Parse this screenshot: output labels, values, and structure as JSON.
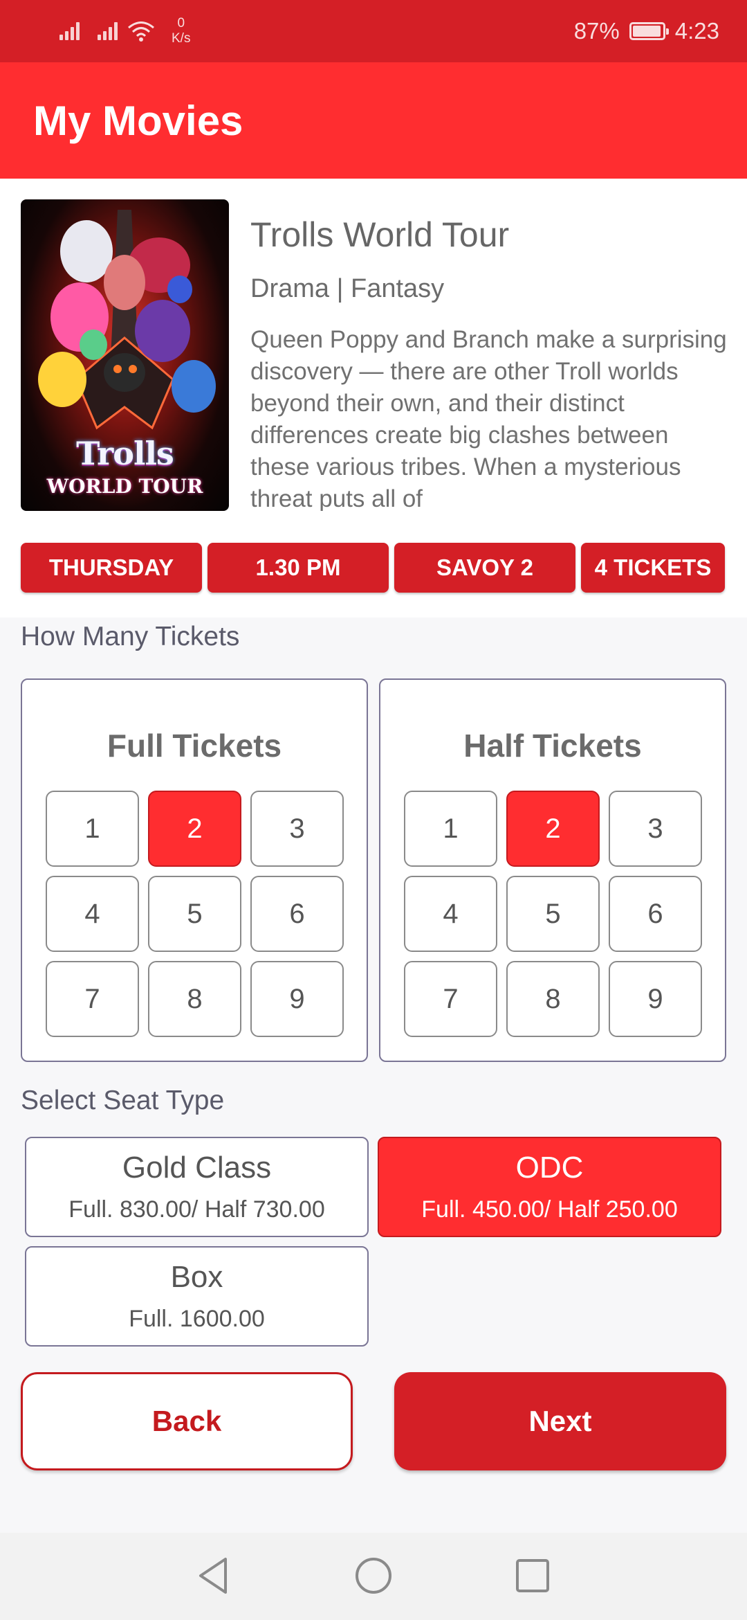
{
  "status_bar": {
    "net_speed_value": "0",
    "net_speed_unit": "K/s",
    "battery": "87%",
    "time": "4:23",
    "icons": [
      "signal-icon",
      "signal-icon",
      "wifi-icon",
      "battery-icon"
    ]
  },
  "app_bar": {
    "title": "My Movies"
  },
  "movie": {
    "poster_title": "Trolls",
    "poster_subtitle": "WORLD TOUR",
    "title": "Trolls World Tour",
    "genre": "Drama | Fantasy",
    "description": "Queen Poppy and Branch make a surprising discovery — there are other Troll worlds beyond their own, and their distinct differences create big clashes between these various tribes. When a mysterious threat puts all of"
  },
  "chips": {
    "day": "THURSDAY",
    "time": "1.30 PM",
    "hall": "SAVOY 2",
    "tickets": "4 TICKETS"
  },
  "ticket_section": {
    "label": "How Many Tickets",
    "full": {
      "title": "Full Tickets",
      "numbers": [
        "1",
        "2",
        "3",
        "4",
        "5",
        "6",
        "7",
        "8",
        "9"
      ],
      "selected": "2"
    },
    "half": {
      "title": "Half Tickets",
      "numbers": [
        "1",
        "2",
        "3",
        "4",
        "5",
        "6",
        "7",
        "8",
        "9"
      ],
      "selected": "2"
    }
  },
  "seat_section": {
    "label": "Select Seat Type",
    "options": [
      {
        "name": "Gold Class",
        "price": "Full. 830.00/ Half 730.00",
        "selected": false
      },
      {
        "name": "ODC",
        "price": "Full. 450.00/ Half 250.00",
        "selected": true
      },
      {
        "name": "Box",
        "price": "Full. 1600.00",
        "selected": false
      }
    ]
  },
  "actions": {
    "back": "Back",
    "next": "Next"
  },
  "colors": {
    "primary": "#ff2d30",
    "primary_dark": "#d41f26",
    "accent_border": "#c41a1e"
  }
}
